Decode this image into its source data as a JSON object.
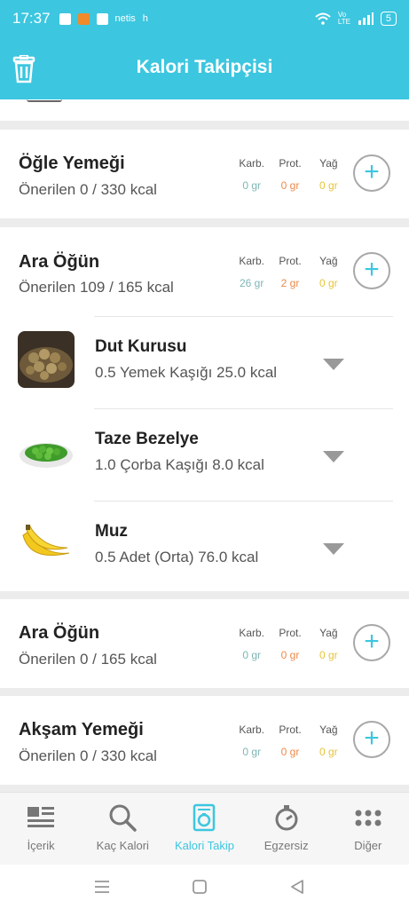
{
  "status_bar": {
    "time": "17:37",
    "app_text": "netis",
    "extra_text": "h",
    "network": "Vo LTE",
    "battery": "5"
  },
  "app_bar": {
    "title": "Kalori Takipçisi",
    "icons": {
      "left": "trash-icon"
    }
  },
  "meals": [
    {
      "title": "Öğle Yemeği",
      "subtitle": "Önerilen 0 / 330 kcal",
      "labels": {
        "carb": "Karb.",
        "prot": "Prot.",
        "fat": "Yağ"
      },
      "values": {
        "carb": "0 gr",
        "prot": "0 gr",
        "fat": "0 gr"
      }
    },
    {
      "title": "Ara Öğün",
      "subtitle": "Önerilen 109 / 165 kcal",
      "labels": {
        "carb": "Karb.",
        "prot": "Prot.",
        "fat": "Yağ"
      },
      "values": {
        "carb": "26 gr",
        "prot": "2 gr",
        "fat": "0 gr"
      },
      "foods": [
        {
          "name": "Dut Kurusu",
          "detail": "0.5 Yemek Kaşığı 25.0 kcal",
          "image": "dried-mulberry"
        },
        {
          "name": "Taze Bezelye",
          "detail": "1.0 Çorba Kaşığı 8.0 kcal",
          "image": "green-peas"
        },
        {
          "name": "Muz",
          "detail": "0.5 Adet (Orta) 76.0 kcal",
          "image": "banana"
        }
      ]
    },
    {
      "title": "Ara Öğün",
      "subtitle": "Önerilen 0 / 165 kcal",
      "labels": {
        "carb": "Karb.",
        "prot": "Prot.",
        "fat": "Yağ"
      },
      "values": {
        "carb": "0 gr",
        "prot": "0 gr",
        "fat": "0 gr"
      }
    },
    {
      "title": "Akşam Yemeği",
      "subtitle": "Önerilen 0 / 330 kcal",
      "labels": {
        "carb": "Karb.",
        "prot": "Prot.",
        "fat": "Yağ"
      },
      "values": {
        "carb": "0 gr",
        "prot": "0 gr",
        "fat": "0 gr"
      }
    }
  ],
  "add_button_symbol": "+",
  "bottom_nav": [
    {
      "label": "İçerik",
      "icon": "content-icon",
      "active": false
    },
    {
      "label": "Kaç Kalori",
      "icon": "search-icon",
      "active": false
    },
    {
      "label": "Kalori Takip",
      "icon": "tracker-icon",
      "active": true
    },
    {
      "label": "Egzersiz",
      "icon": "stopwatch-icon",
      "active": false
    },
    {
      "label": "Diğer",
      "icon": "more-icon",
      "active": false
    }
  ],
  "colors": {
    "accent": "#3cc6e0",
    "carb": "#7fb5b5",
    "prot": "#ee8a4a",
    "fat": "#e8c43a"
  }
}
